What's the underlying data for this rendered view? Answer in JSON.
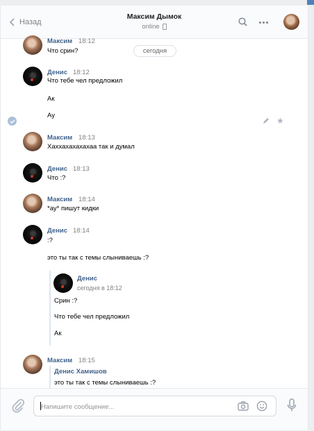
{
  "header": {
    "back_label": "Назад",
    "title": "Максим Дымок",
    "status": "online"
  },
  "date_separator": "сегодня",
  "messages": [
    {
      "sender": "Максим",
      "time": "18:12",
      "lines": [
        "Что срин?"
      ]
    },
    {
      "sender": "Денис",
      "time": "18:12",
      "lines": [
        "Что тебе чел предложил",
        "Ак",
        "Ау"
      ]
    },
    {
      "sender": "Максим",
      "time": "18:13",
      "lines": [
        "Хаххахахахахаа так и думал"
      ]
    },
    {
      "sender": "Денис",
      "time": "18:13",
      "lines": [
        "Что :?"
      ]
    },
    {
      "sender": "Максим",
      "time": "18:14",
      "lines": [
        "*ау* пишут кидки"
      ]
    },
    {
      "sender": "Денис",
      "time": "18:14",
      "lines": [
        ":?",
        "это ты так с темы слыниваешь :?"
      ]
    },
    {
      "sender": "Максим",
      "time": "18:15",
      "lines": []
    }
  ],
  "forwarded": {
    "sender": "Денис",
    "time": "сегодня в 18:12",
    "lines": [
      "Срин :?",
      "Что тебе чел предложил",
      "Ак"
    ]
  },
  "reply": {
    "sender": "Денис Хамишов",
    "text": "это ты так с темы слыниваешь :?"
  },
  "composer": {
    "placeholder": "Напишите сообщение..."
  },
  "colors": {
    "accent": "#5181b8",
    "name": "#42648b",
    "muted": "#828282",
    "selected_check": "#aac1d9"
  }
}
